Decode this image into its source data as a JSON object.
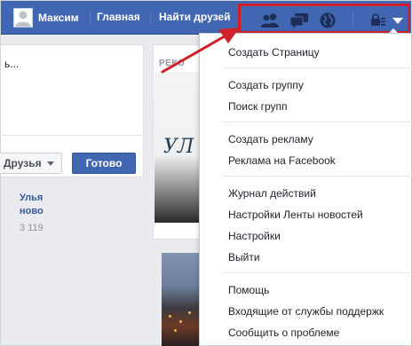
{
  "topbar": {
    "profile_name": "Максим",
    "nav": [
      "Главная",
      "Найти друзей"
    ]
  },
  "left_card": {
    "title_fragment": "ь...",
    "friends_select": "Друзья",
    "done_button": "Готово"
  },
  "mid_card": {
    "rec_label": "РЕКО",
    "ad_image_text": "УЛ",
    "ad_title_lines": [
      "Улья",
      "ново"
    ],
    "ad_sub": "3 119"
  },
  "menu": {
    "groups": [
      [
        "Создать Страницу"
      ],
      [
        "Создать группу",
        "Поиск групп"
      ],
      [
        "Создать рекламу",
        "Реклама на Facebook"
      ],
      [
        "Журнал действий",
        "Настройки Ленты новостей",
        "Настройки",
        "Выйти"
      ],
      [
        "Помощь",
        "Входящие от службы поддержк",
        "Сообщить о проблеме"
      ]
    ]
  },
  "icons": {
    "friends": "friend-requests-icon",
    "messages": "messages-icon",
    "notifications": "globe-notifications-icon",
    "privacy": "lock-privacy-icon",
    "account": "account-menu-arrow-icon"
  },
  "colors": {
    "topbar": "#4267b2",
    "highlight": "#d0202a",
    "link": "#365899"
  }
}
